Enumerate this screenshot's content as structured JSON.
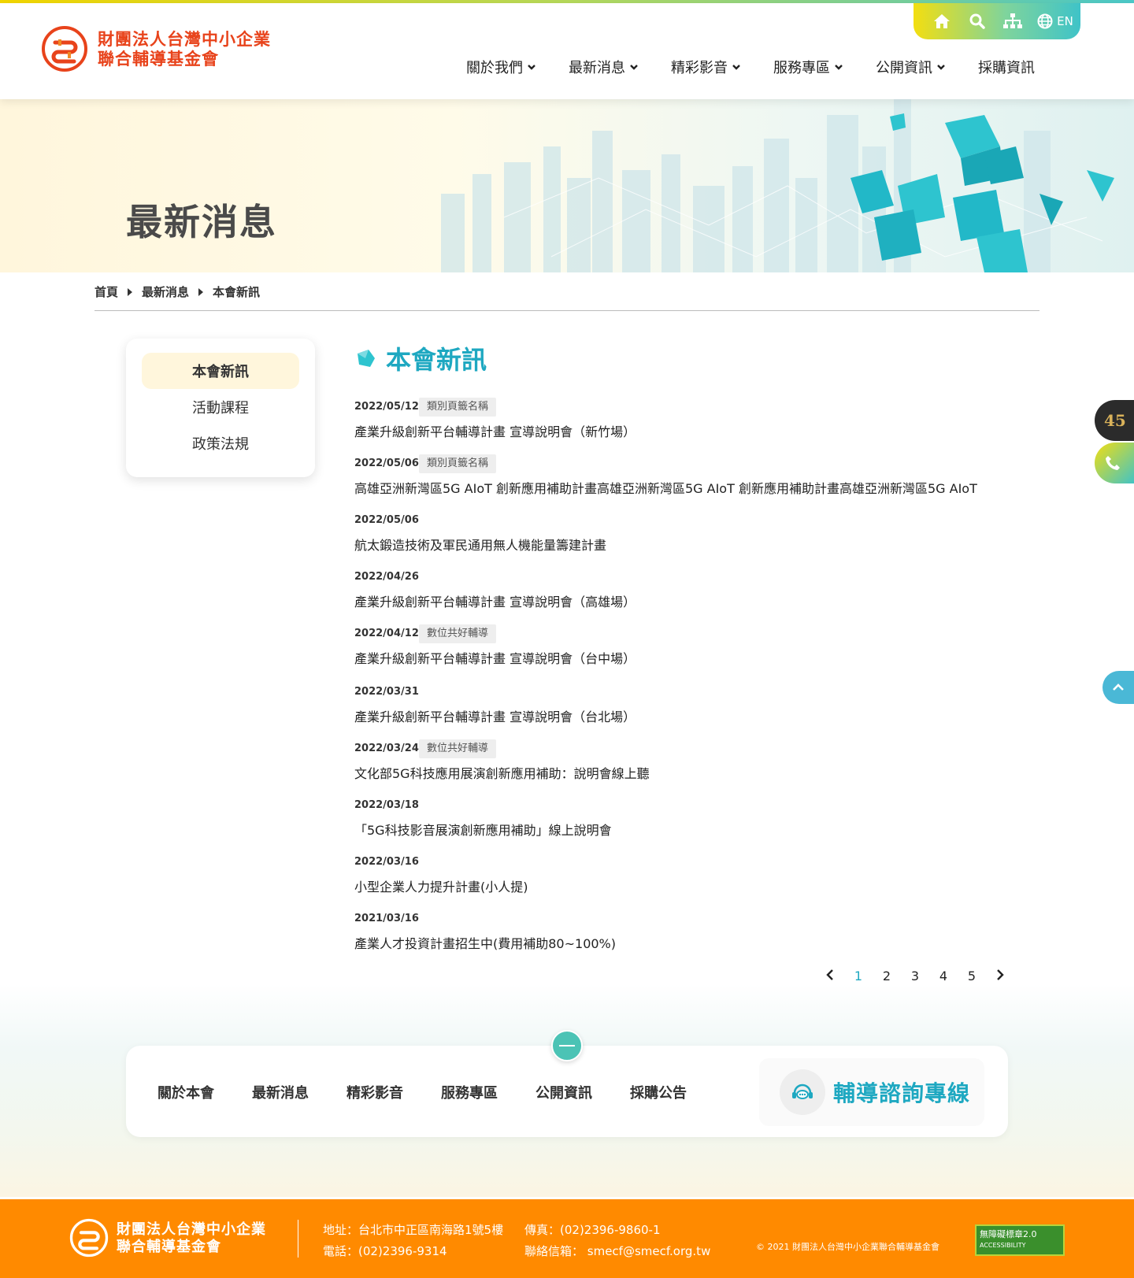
{
  "org": {
    "name_line1": "財團法人台灣中小企業",
    "name_line2": "聯合輔導基金會"
  },
  "util": {
    "en_label": "EN"
  },
  "nav": [
    {
      "label": "關於我們",
      "has_menu": true
    },
    {
      "label": "最新消息",
      "has_menu": true
    },
    {
      "label": "精彩影音",
      "has_menu": true
    },
    {
      "label": "服務專區",
      "has_menu": true
    },
    {
      "label": "公開資訊",
      "has_menu": true
    },
    {
      "label": "採購資訊",
      "has_menu": false
    }
  ],
  "hero": {
    "title": "最新消息"
  },
  "breadcrumb": [
    "首頁",
    "最新消息",
    "本會新訊"
  ],
  "sidebar": {
    "items": [
      "本會新訊",
      "活動課程",
      "政策法規"
    ],
    "active": 0
  },
  "section": {
    "title": "本會新訊"
  },
  "news": [
    {
      "date": "2022/05/12",
      "tag": "類別頁籤名稱",
      "title": "產業升級創新平台輔導計畫 宣導說明會（新竹場）"
    },
    {
      "date": "2022/05/06",
      "tag": "類別頁籤名稱",
      "title": "高雄亞洲新灣區5G AIoT 創新應用補助計畫高雄亞洲新灣區5G AIoT 創新應用補助計畫高雄亞洲新灣區5G AIoT"
    },
    {
      "date": "2022/05/06",
      "tag": "",
      "title": "航太鍛造技術及軍民通用無人機能量籌建計畫"
    },
    {
      "date": "2022/04/26",
      "tag": "",
      "title": "產業升級創新平台輔導計畫 宣導說明會（高雄場）"
    },
    {
      "date": "2022/04/12",
      "tag": "數位共好輔導",
      "title": "產業升級創新平台輔導計畫 宣導說明會（台中場）"
    },
    {
      "date": "2022/03/31",
      "tag": "",
      "title": "產業升級創新平台輔導計畫 宣導說明會（台北場）"
    },
    {
      "date": "2022/03/24",
      "tag": "數位共好輔導",
      "title": "文化部5G科技應用展演創新應用補助：說明會線上聽"
    },
    {
      "date": "2022/03/18",
      "tag": "",
      "title": "「5G科技影音展演創新應用補助」線上說明會"
    },
    {
      "date": "2022/03/16",
      "tag": "",
      "title": "小型企業人力提升計畫(小人提)"
    },
    {
      "date": "2021/03/16",
      "tag": "",
      "title": "產業人才投資計畫招生中(費用補助80~100%)"
    }
  ],
  "pager": {
    "pages": [
      "1",
      "2",
      "3",
      "4",
      "5"
    ],
    "current": "1"
  },
  "footnav": {
    "links": [
      "關於本會",
      "最新消息",
      "精彩影音",
      "服務專區",
      "公開資訊",
      "採購公告"
    ],
    "hotline": "輔導諮詢專線"
  },
  "footer": {
    "address": "地址：台北市中正區南海路1號5樓",
    "phone": "電話：(02)2396-9314",
    "fax": "傳真：(02)2396-9860-1",
    "email": "聯絡信箱：  smecf@smecf.org.tw",
    "copyright": "© 2021 財團法人台灣中小企業聯合輔導基金會",
    "badge_line1": "無障礙標章2.0",
    "badge_line2": "ACCESSIBILITY"
  },
  "colors": {
    "accent": "#1ea8c1",
    "brand_orange": "#ff8a00",
    "logo_red": "#e8431b"
  }
}
